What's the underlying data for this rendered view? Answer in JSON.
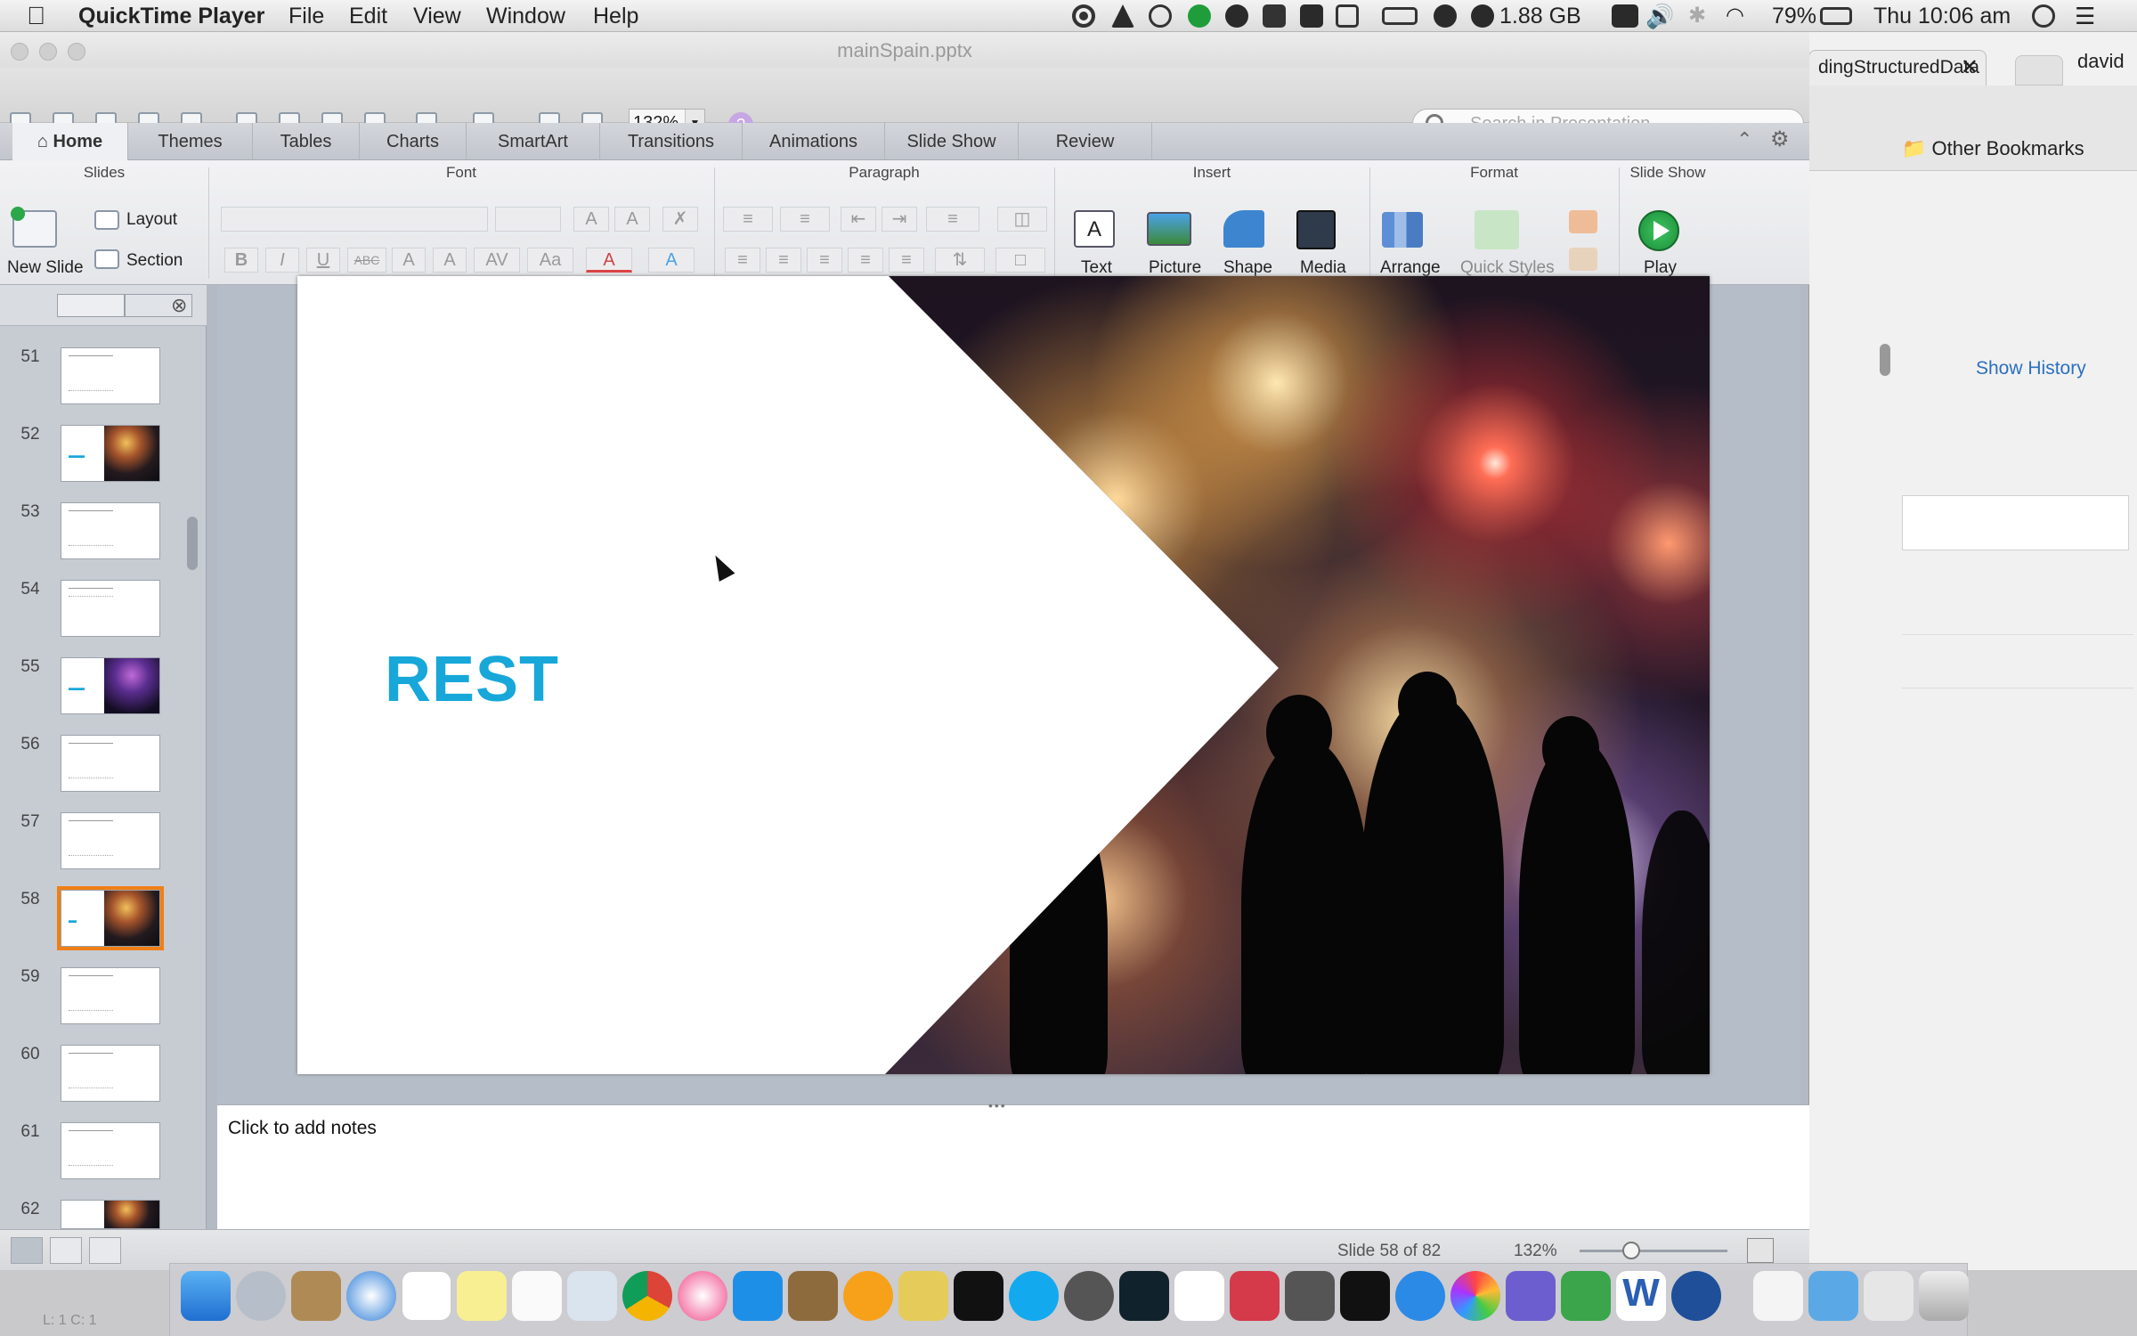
{
  "menubar": {
    "app_name": "QuickTime Player",
    "menus": [
      "File",
      "Edit",
      "View",
      "Window",
      "Help"
    ],
    "memory": "1.88 GB",
    "battery": "79%",
    "clock": "Thu 10:06 am"
  },
  "background_window": {
    "tab_title": "dingStructuredData",
    "user": "david",
    "bookmarks": "Other Bookmarks",
    "show_history": "Show History"
  },
  "powerpoint": {
    "doc_title": "mainSpain.pptx",
    "zoom": "132%",
    "search_placeholder": "Search in Presentation",
    "tabs": [
      "Home",
      "Themes",
      "Tables",
      "Charts",
      "SmartArt",
      "Transitions",
      "Animations",
      "Slide Show",
      "Review"
    ],
    "ribbon": {
      "groups": {
        "slides": "Slides",
        "font": "Font",
        "paragraph": "Paragraph",
        "insert": "Insert",
        "format": "Format",
        "slide_show": "Slide Show"
      },
      "new_slide": "New Slide",
      "layout": "Layout",
      "section": "Section",
      "text": "Text",
      "picture": "Picture",
      "shape": "Shape",
      "media": "Media",
      "arrange": "Arrange",
      "quick_styles": "Quick Styles",
      "play": "Play"
    },
    "thumbnails": [
      "51",
      "52",
      "53",
      "54",
      "55",
      "56",
      "57",
      "58",
      "59",
      "60",
      "61",
      "62"
    ],
    "selected_thumbnail": "58",
    "slide": {
      "title": "REST"
    },
    "notes_placeholder": "Click to add notes",
    "status": {
      "slide_indicator": "Slide 58 of 82",
      "zoom": "132%"
    }
  },
  "bottom_left": "L: 1 C: 1"
}
